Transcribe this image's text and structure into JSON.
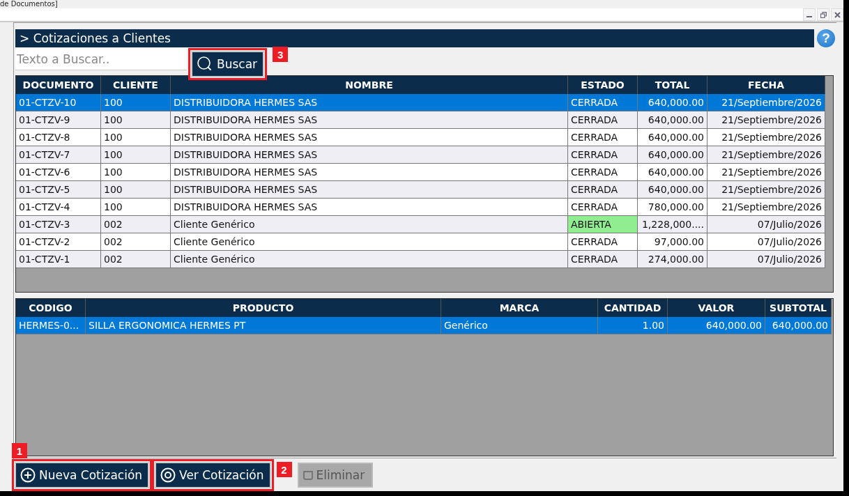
{
  "window": {
    "title": "de Documentos]"
  },
  "header": {
    "title": "> Cotizaciones a Clientes",
    "help_label": "?"
  },
  "search": {
    "placeholder": "Texto a Buscar..",
    "button": {
      "label": "Buscar",
      "highlighted": true,
      "callout": "3"
    }
  },
  "quotes_table": {
    "columns": [
      "DOCUMENTO",
      "CLIENTE",
      "NOMBRE",
      "ESTADO",
      "TOTAL",
      "FECHA"
    ],
    "rows": [
      {
        "selected": true,
        "cells": [
          "01-CTZV-10",
          "100",
          "DISTRIBUIDORA HERMES SAS",
          "CERRADA",
          "640,000.00",
          "21/Septiembre/2026"
        ]
      },
      {
        "selected": false,
        "cells": [
          "01-CTZV-9",
          "100",
          "DISTRIBUIDORA HERMES SAS",
          "CERRADA",
          "640,000.00",
          "21/Septiembre/2026"
        ]
      },
      {
        "selected": false,
        "cells": [
          "01-CTZV-8",
          "100",
          "DISTRIBUIDORA HERMES SAS",
          "CERRADA",
          "640,000.00",
          "21/Septiembre/2026"
        ]
      },
      {
        "selected": false,
        "cells": [
          "01-CTZV-7",
          "100",
          "DISTRIBUIDORA HERMES SAS",
          "CERRADA",
          "640,000.00",
          "21/Septiembre/2026"
        ]
      },
      {
        "selected": false,
        "cells": [
          "01-CTZV-6",
          "100",
          "DISTRIBUIDORA HERMES SAS",
          "CERRADA",
          "640,000.00",
          "21/Septiembre/2026"
        ]
      },
      {
        "selected": false,
        "cells": [
          "01-CTZV-5",
          "100",
          "DISTRIBUIDORA HERMES SAS",
          "CERRADA",
          "640,000.00",
          "21/Septiembre/2026"
        ]
      },
      {
        "selected": false,
        "cells": [
          "01-CTZV-4",
          "100",
          "DISTRIBUIDORA HERMES SAS",
          "CERRADA",
          "780,000.00",
          "21/Septiembre/2026"
        ]
      },
      {
        "selected": false,
        "color": "#90ee90",
        "cells": [
          "01-CTZV-3",
          "002",
          "Cliente Genérico",
          "ABIERTA",
          "1,228,000....",
          "07/Julio/2026"
        ]
      },
      {
        "selected": false,
        "cells": [
          "01-CTZV-2",
          "002",
          "Cliente Genérico",
          "CERRADA",
          "97,000.00",
          "07/Julio/2026"
        ]
      },
      {
        "selected": false,
        "cells": [
          "01-CTZV-1",
          "002",
          "Cliente Genérico",
          "CERRADA",
          "274,000.00",
          "07/Julio/2026"
        ]
      }
    ]
  },
  "items_table": {
    "columns": [
      "CODIGO",
      "PRODUCTO",
      "MARCA",
      "CANTIDAD",
      "VALOR",
      "SUBTOTAL"
    ],
    "rows": [
      {
        "selected": true,
        "cells": [
          "HERMES-0...",
          "SILLA ERGONOMICA HERMES PT",
          "Genérico",
          "1.00",
          "640,000.00",
          "640,000.00"
        ]
      }
    ]
  },
  "actions": [
    {
      "kind": "new",
      "label": "Nueva Cotización",
      "disabled": false,
      "highlighted": true,
      "callout": "1"
    },
    {
      "kind": "view",
      "label": "Ver Cotización",
      "disabled": false,
      "highlighted": true,
      "callout": "2"
    },
    {
      "kind": "delete",
      "label": "Eliminar",
      "disabled": true,
      "highlighted": false
    }
  ]
}
